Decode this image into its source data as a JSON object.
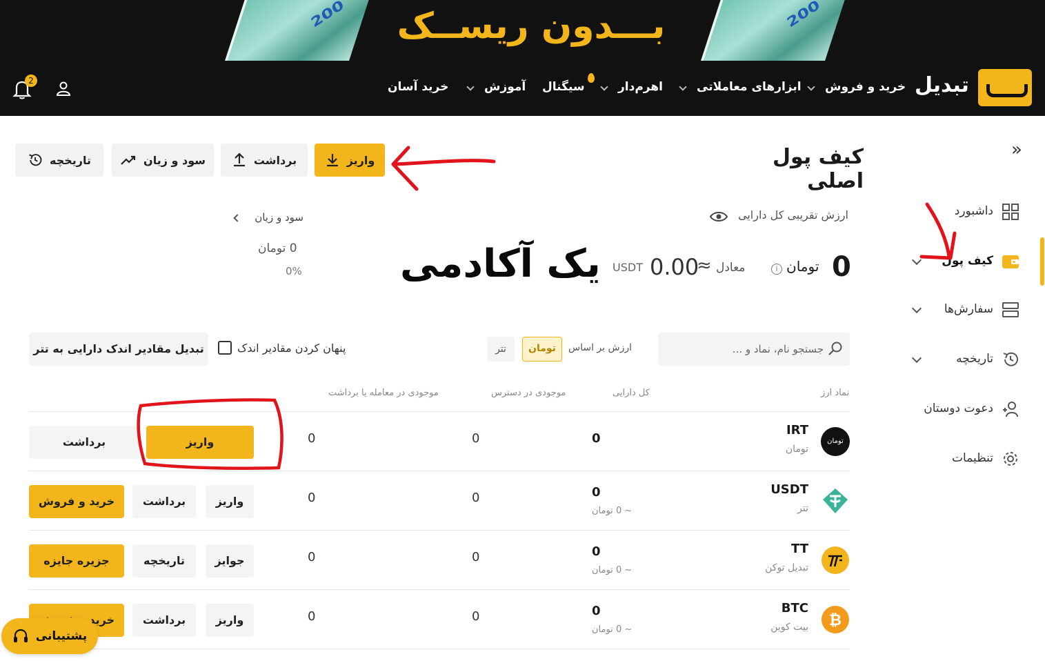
{
  "banner": {
    "text": "بـــدون ریســک",
    "note_label": "200"
  },
  "nav": {
    "brand": "تبدیل",
    "items": [
      {
        "label": "خرید و فروش"
      },
      {
        "label": "ابزارهای معاملاتی"
      },
      {
        "label": "اهرم‌دار"
      },
      {
        "label": "سیگنال"
      },
      {
        "label": "آموزش"
      },
      {
        "label": "خرید آسان"
      }
    ],
    "notification_count": "2"
  },
  "sidebar": {
    "items": [
      {
        "label": "داشبورد",
        "icon": "dashboard-icon"
      },
      {
        "label": "کیف پول",
        "icon": "wallet-icon",
        "active": true
      },
      {
        "label": "سفارش‌ها",
        "icon": "orders-icon"
      },
      {
        "label": "تاریخچه",
        "icon": "history-icon"
      },
      {
        "label": "دعوت دوستان",
        "icon": "invite-icon"
      },
      {
        "label": "تنظیمات",
        "icon": "gear-icon"
      }
    ]
  },
  "header": {
    "title": "کیف پول اصلی",
    "deposit": "واریز",
    "withdraw": "برداشت",
    "pnl": "سود و زیان",
    "history": "تاریخچه"
  },
  "summary": {
    "estimated_label": "ارزش تقریبی کل دارایی",
    "total_value": "0",
    "total_unit": "تومان",
    "equivalent_label": "معادل",
    "approx_sign": "≈",
    "usdt_value": "0.00",
    "usdt_unit": "USDT",
    "pnl_label": "سود و زیان",
    "pnl_value": "0  تومان",
    "pnl_percent": "0%"
  },
  "overlay_text": "یک آکادمی",
  "filters": {
    "search_placeholder": "جستجو نام، نماد و ...",
    "value_basis_label": "ارزش بر اساس",
    "toman": "تومان",
    "tether": "تتر",
    "hide_small": "پنهان کردن مقادیر اندک",
    "convert_small": "تبدیل مقادیر اندک دارایی به تتر"
  },
  "table": {
    "headers": {
      "symbol": "نماد ارز",
      "total": "کل دارایی",
      "available": "موجودی در دسترس",
      "in_order": "موجودی در معامله یا برداشت"
    },
    "rows": [
      {
        "symbol": "IRT",
        "name": "تومان",
        "coin_badge": "تومان",
        "total": "0",
        "total_sub": "",
        "available": "0",
        "in_order": "0",
        "actions": [
          "واریز",
          "برداشت"
        ]
      },
      {
        "symbol": "USDT",
        "name": "تتر",
        "coin_badge": "",
        "total": "0",
        "total_sub": "~ 0 تومان",
        "available": "0",
        "in_order": "0",
        "actions": [
          "واریز",
          "برداشت",
          "خرید و فروش"
        ]
      },
      {
        "symbol": "TT",
        "name": "تبدیل توکن",
        "coin_badge": "",
        "total": "0",
        "total_sub": "~ 0 تومان",
        "available": "0",
        "in_order": "0",
        "actions": [
          "جوایز",
          "تاریخچه",
          "جزیره جایزه"
        ]
      },
      {
        "symbol": "BTC",
        "name": "بیت کوین",
        "coin_badge": "",
        "total": "0",
        "total_sub": "~ 0 تومان",
        "available": "0",
        "in_order": "0",
        "actions": [
          "واریز",
          "برداشت",
          "خرید و فروش"
        ]
      }
    ]
  },
  "support": {
    "label": "پشتیبانی"
  },
  "colors": {
    "accent": "#f3b51c",
    "dark": "#111111",
    "annotation": "#e0141a"
  }
}
